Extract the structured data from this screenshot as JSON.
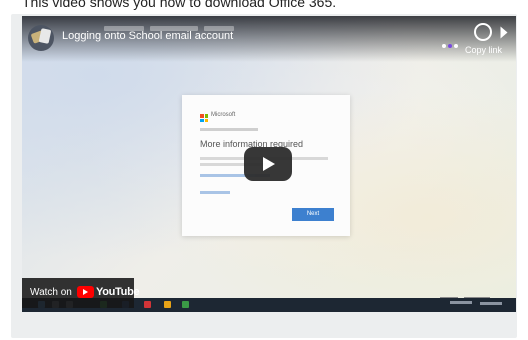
{
  "caption": "This video shows you how to download Office 365.",
  "video": {
    "title": "Logging onto School email account",
    "copy_link": "Copy link",
    "watch_on": "Watch on",
    "youtube": "YouTube"
  },
  "dialog": {
    "brand": "Microsoft",
    "heading": "More information required",
    "next": "Next"
  },
  "colors": {
    "youtube_red": "#ff0000",
    "ms_red": "#f25022",
    "ms_green": "#7fba00",
    "ms_blue": "#00a4ef",
    "ms_yellow": "#ffb900",
    "button_blue": "#3d80cf"
  }
}
